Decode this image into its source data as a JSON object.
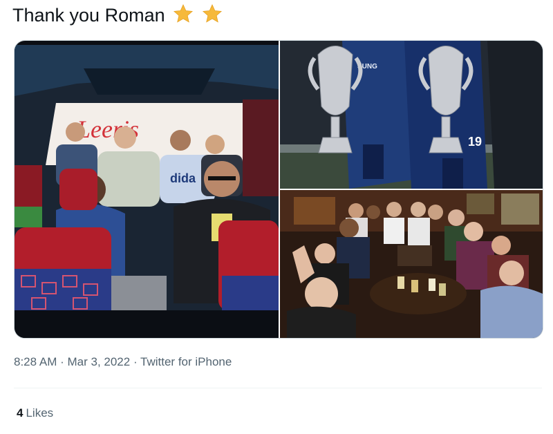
{
  "tweet": {
    "text": "Thank you Roman",
    "emoji": [
      "star-icon",
      "star-icon"
    ],
    "star_color": "#f6b93b"
  },
  "media": {
    "photos": [
      {
        "id": "bus-photo",
        "subject": "bus-interior-group"
      },
      {
        "id": "trophy-photo",
        "subject": "players-with-trophies"
      },
      {
        "id": "pub-photo",
        "subject": "pub-group-selfie"
      }
    ],
    "jersey_number": "19"
  },
  "meta": {
    "time": "8:28 AM",
    "separator": " · ",
    "date": "Mar 3, 2022",
    "source": "Twitter for iPhone"
  },
  "stats": {
    "likes_count": "4",
    "likes_label": "Likes"
  },
  "colors": {
    "text_primary": "#0f1419",
    "text_secondary": "#536471",
    "border": "#cfd9de",
    "divider": "#eff3f4"
  }
}
